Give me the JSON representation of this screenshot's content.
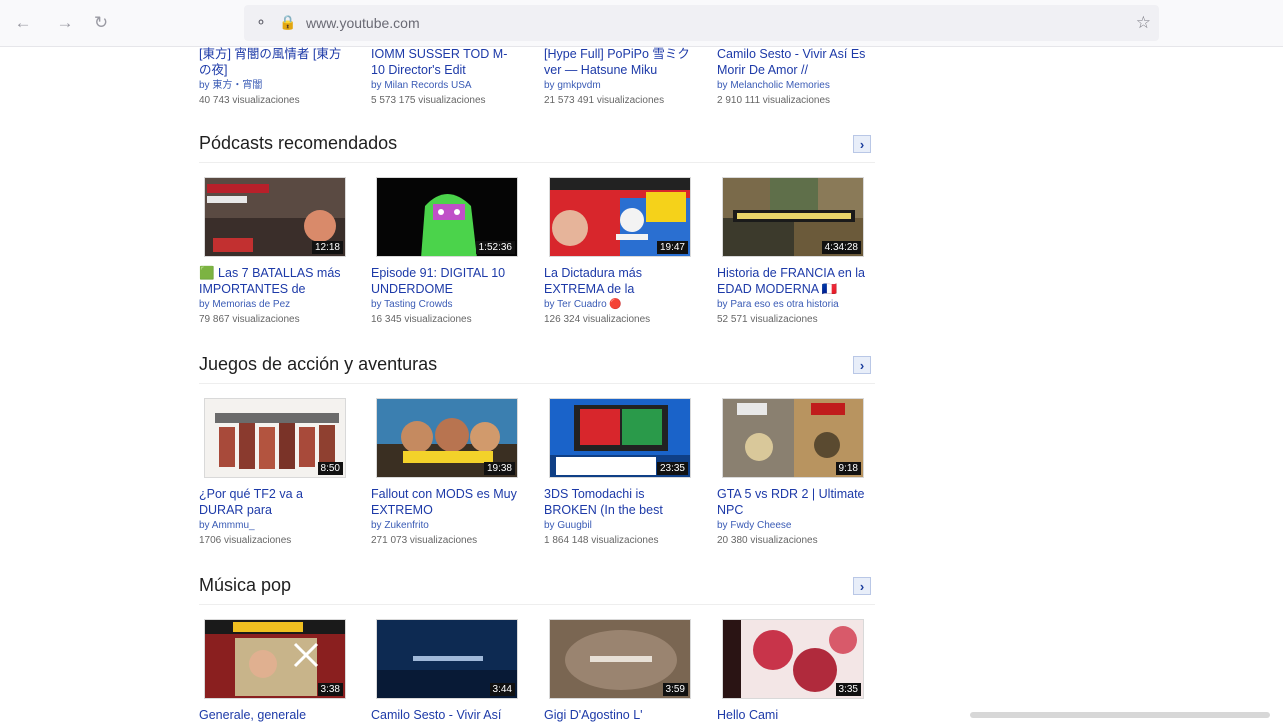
{
  "browser": {
    "url": "www.youtube.com",
    "back_icon": "arrow-left-icon",
    "forward_icon": "arrow-right-icon",
    "reload_icon": "reload-icon",
    "star_icon": "star-icon"
  },
  "top_row": [
    {
      "title": "[東方] 宵闇の風情者 [東方の夜]",
      "author": "by 東方・宵闇",
      "views": "40 743 visualizaciones"
    },
    {
      "title": "IOMM SUSSER TOD M-10 Director's Edit",
      "author": "by Milan Records USA",
      "views": "5 573 175 visualizaciones"
    },
    {
      "title": "[Hype Full] PoPiPo 雪ミク ver — Hatsune Miku",
      "author": "by gmkpvdm",
      "views": "21 573 491 visualizaciones"
    },
    {
      "title": "Camilo Sesto - Vivir Así Es Morir De Amor //",
      "author": "by Melancholic Memories",
      "views": "2 910 111 visualizaciones"
    }
  ],
  "sections": [
    {
      "title": "Pódcasts recomendados",
      "videos": [
        {
          "title": "🟩 Las 7 BATALLAS más IMPORTANTES de",
          "author": "by Memorias de Pez",
          "views": "79 867 visualizaciones",
          "duration": "12:18"
        },
        {
          "title": "Episode 91: DIGITAL 10 UNDERDOME",
          "author": "by Tasting Crowds",
          "views": "16 345 visualizaciones",
          "duration": "1:52:36"
        },
        {
          "title": "La Dictadura más EXTREMA de la",
          "author": "by Ter Cuadro 🔴",
          "views": "126 324 visualizaciones",
          "duration": "19:47"
        },
        {
          "title": "Historia de FRANCIA en la EDAD MODERNA 🇫🇷",
          "author": "by Para eso es otra historia",
          "views": "52 571 visualizaciones",
          "duration": "4:34:28"
        }
      ]
    },
    {
      "title": "Juegos de acción y aventuras",
      "videos": [
        {
          "title": "¿Por qué TF2 va a DURAR para",
          "author": "by Ammmu_",
          "views": "1706 visualizaciones",
          "duration": "8:50"
        },
        {
          "title": "Fallout con MODS es Muy EXTREMO",
          "author": "by Zukenfrito",
          "views": "271 073 visualizaciones",
          "duration": "19:38"
        },
        {
          "title": "3DS Tomodachi is BROKEN (In the best",
          "author": "by Guugbil",
          "views": "1 864 148 visualizaciones",
          "duration": "23:35"
        },
        {
          "title": "GTA 5 vs RDR 2 | Ultimate NPC",
          "author": "by Fwdy Cheese",
          "views": "20 380 visualizaciones",
          "duration": "9:18"
        }
      ]
    },
    {
      "title": "Música pop",
      "videos": [
        {
          "title": "Generale, generale",
          "author": "",
          "views": "",
          "duration": "3:38"
        },
        {
          "title": "Camilo Sesto - Vivir Así",
          "author": "",
          "views": "",
          "duration": "3:44"
        },
        {
          "title": "Gigi D'Agostino L'",
          "author": "",
          "views": "",
          "duration": "3:59"
        },
        {
          "title": "Hello Cami",
          "author": "",
          "views": "",
          "duration": "3:35"
        }
      ]
    }
  ]
}
